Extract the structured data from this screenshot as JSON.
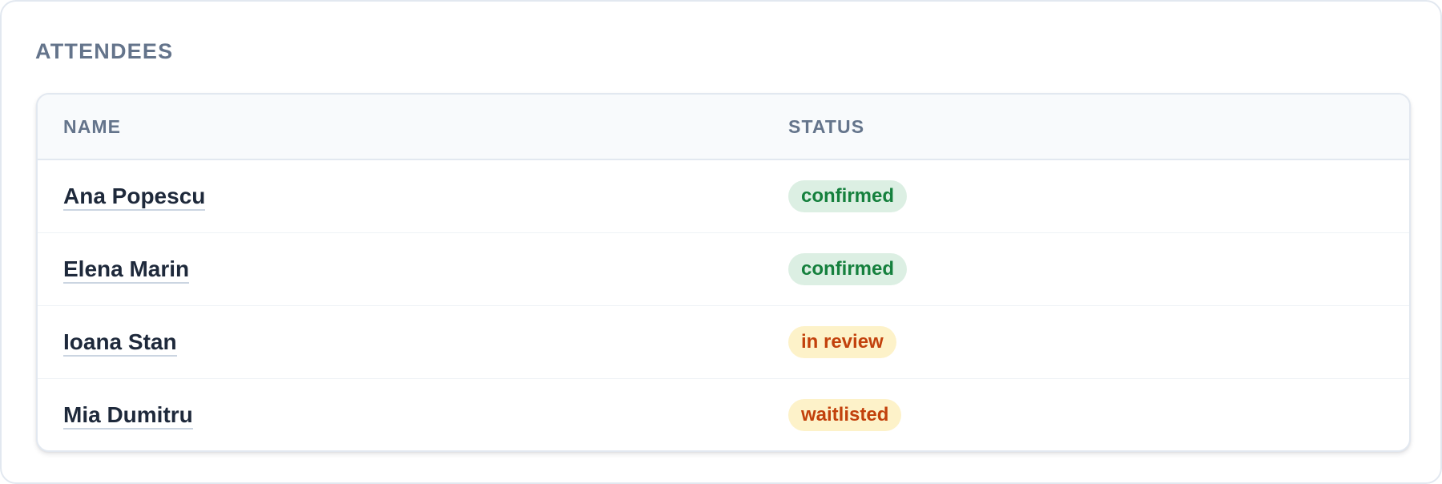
{
  "section": {
    "title": "ATTENDEES"
  },
  "table": {
    "columns": {
      "name": "NAME",
      "status": "STATUS"
    },
    "rows": [
      {
        "name": "Ana Popescu",
        "status": "confirmed",
        "tone": "confirmed"
      },
      {
        "name": "Elena Marin",
        "status": "confirmed",
        "tone": "confirmed"
      },
      {
        "name": "Ioana Stan",
        "status": "in review",
        "tone": "pending"
      },
      {
        "name": "Mia Dumitru",
        "status": "waitlisted",
        "tone": "pending"
      }
    ]
  },
  "colors": {
    "confirmed_text": "#15803d",
    "confirmed_bg": "#dcefe3",
    "pending_text": "#c2410c",
    "pending_bg": "#fdf2c9",
    "heading": "#64748b",
    "name_text": "#1e293b"
  }
}
